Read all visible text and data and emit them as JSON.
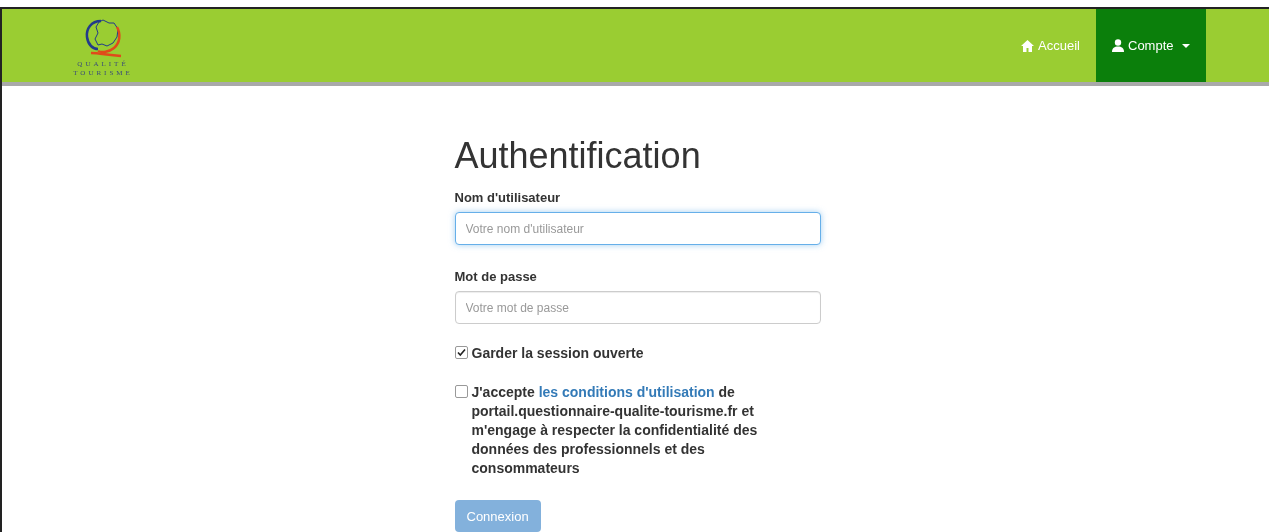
{
  "navbar": {
    "logo_text": [
      "QUALITÉ",
      "TOURISME"
    ],
    "items": [
      {
        "label": "Accueil",
        "kind": "home",
        "selected": false,
        "dropdown": false
      },
      {
        "label": "Compte",
        "kind": "account",
        "selected": true,
        "dropdown": true
      }
    ]
  },
  "form": {
    "title": "Authentification",
    "fields": [
      {
        "label": "Nom d'utilisateur",
        "placeholder": "Votre nom d'utilisateur",
        "focused": true
      },
      {
        "label": "Mot de passe",
        "placeholder": "Votre mot de passe",
        "focused": false
      }
    ],
    "remember": {
      "label": "Garder la session ouverte",
      "checked": true
    },
    "terms": {
      "checked": false,
      "before": "J'accepte",
      "link": "les conditions d'utilisation",
      "after": "de portail.questionnaire-qualite-tourisme.fr et m'engage à respecter la confidentialité des données des professionnels et des consommateurs"
    },
    "submit": {
      "label": "Connexion",
      "disabled": true
    }
  }
}
